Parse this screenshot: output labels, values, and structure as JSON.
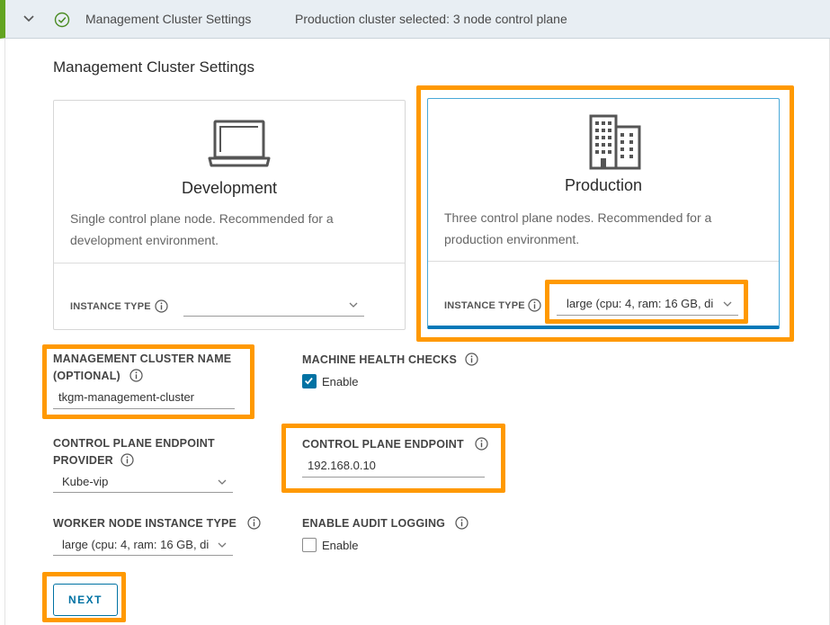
{
  "header": {
    "title": "Management Cluster Settings",
    "summary": "Production cluster selected: 3 node control plane"
  },
  "section": {
    "title": "Management Cluster Settings"
  },
  "cards": {
    "development": {
      "title": "Development",
      "description": "Single control plane node. Recommended for a development environment.",
      "instance_type_label": "INSTANCE TYPE",
      "instance_type_value": ""
    },
    "production": {
      "title": "Production",
      "description": "Three control plane nodes. Recommended for a production environment.",
      "instance_type_label": "INSTANCE TYPE",
      "instance_type_value": "large (cpu: 4, ram: 16 GB, di"
    }
  },
  "fields": {
    "cluster_name": {
      "label_line1": "MANAGEMENT CLUSTER NAME",
      "label_line2": "(OPTIONAL)",
      "value": "tkgm-management-cluster"
    },
    "machine_health": {
      "label": "MACHINE HEALTH CHECKS",
      "option": "Enable",
      "checked": true
    },
    "endpoint_provider": {
      "label_line1": "CONTROL PLANE ENDPOINT",
      "label_line2": "PROVIDER",
      "value": "Kube-vip"
    },
    "endpoint": {
      "label": "CONTROL PLANE ENDPOINT",
      "value": "192.168.0.10"
    },
    "worker_instance": {
      "label": "WORKER NODE INSTANCE TYPE",
      "value": "large (cpu: 4, ram: 16 GB, di"
    },
    "audit_logging": {
      "label": "ENABLE AUDIT LOGGING",
      "option": "Enable",
      "checked": false
    }
  },
  "actions": {
    "next_label": "NEXT"
  },
  "colors": {
    "highlight": "#ff9900",
    "accent": "#0072a3",
    "success": "#62a420"
  }
}
